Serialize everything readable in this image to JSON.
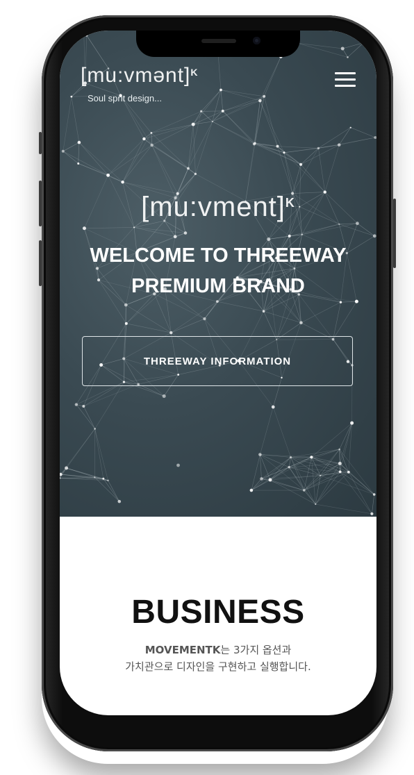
{
  "header": {
    "logo_text": "[mu:vmənt]",
    "logo_sup": "K",
    "tagline": "Soul sprit design..."
  },
  "hero": {
    "logo_text": "[mu:vment]",
    "logo_sup": "K",
    "title_line1": "WELCOME TO THREEWAY",
    "title_line2": "PREMIUM BRAND",
    "button_label": "THREEWAY INFORMATION"
  },
  "business": {
    "title": "BUSINESS",
    "desc_bold": "MOVEMENTK",
    "desc_line1_rest": "는 3가지 옵션과",
    "desc_line2": "가치관으로 디자인을 구현하고 실행합니다."
  },
  "colors": {
    "hero_bg": "#3a4a52",
    "network_lines": "#c9d3d7",
    "text_dark": "#111111",
    "text_muted": "#555555"
  },
  "icons": [
    "menu-icon",
    "camera-icon",
    "speaker-icon"
  ]
}
